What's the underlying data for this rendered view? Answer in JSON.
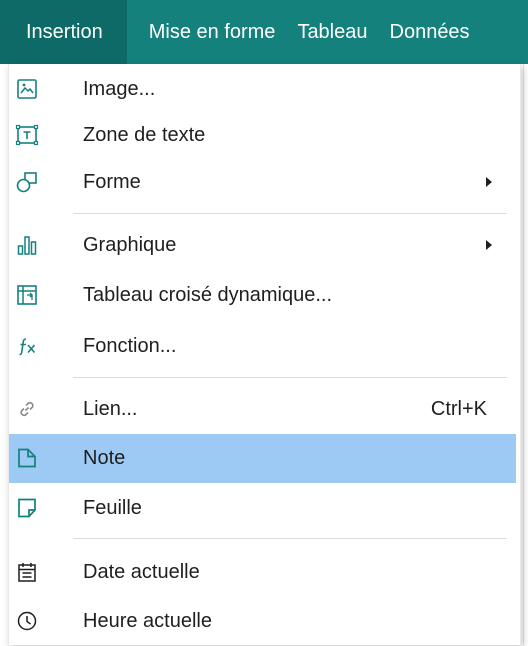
{
  "menubar": {
    "items": [
      {
        "label": "Insertion"
      },
      {
        "label": "Mise en forme"
      },
      {
        "label": "Tableau"
      },
      {
        "label": "Données"
      }
    ]
  },
  "menu": {
    "items": [
      {
        "label": "Image...",
        "icon": "image-icon"
      },
      {
        "label": "Zone de texte",
        "icon": "text-box-icon"
      },
      {
        "label": "Forme",
        "icon": "shape-icon"
      },
      {
        "label": "Graphique",
        "icon": "bar-chart-icon"
      },
      {
        "label": "Tableau croisé dynamique...",
        "icon": "pivot-table-icon"
      },
      {
        "label": "Fonction...",
        "icon": "function-icon"
      },
      {
        "label": "Lien...",
        "icon": "link-icon",
        "shortcut": "Ctrl+K"
      },
      {
        "label": "Note",
        "icon": "note-icon"
      },
      {
        "label": "Feuille",
        "icon": "sheet-icon"
      },
      {
        "label": "Date actuelle",
        "icon": "calendar-icon"
      },
      {
        "label": "Heure actuelle",
        "icon": "clock-icon"
      }
    ]
  },
  "colors": {
    "menubar": "#14817c",
    "menubar_active": "#0e6a66",
    "icon_accent": "#14817c",
    "highlight": "#9ccaf5"
  }
}
